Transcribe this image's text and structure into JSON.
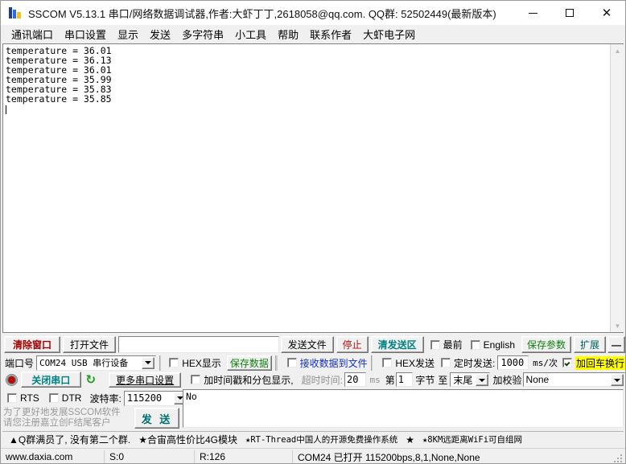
{
  "window": {
    "title": "SSCOM V5.13.1 串口/网络数据调试器,作者:大虾丁丁,2618058@qq.com. QQ群: 52502449(最新版本)",
    "minimize": "─",
    "maximize": "",
    "close": "✕"
  },
  "menu": {
    "items": [
      {
        "label": "通讯端口"
      },
      {
        "label": "串口设置"
      },
      {
        "label": "显示"
      },
      {
        "label": "发送"
      },
      {
        "label": "多字符串"
      },
      {
        "label": "小工具"
      },
      {
        "label": "帮助"
      },
      {
        "label": "联系作者"
      },
      {
        "label": "大虾电子网"
      }
    ]
  },
  "terminal": {
    "text": "temperature = 36.01\ntemperature = 36.13\ntemperature = 36.01\ntemperature = 35.99\ntemperature = 35.83\ntemperature = 35.85\n"
  },
  "toolbar_top": {
    "clear_window": "清除窗口",
    "open_file": "打开文件",
    "file_path": "",
    "send_file": "发送文件",
    "stop": "停止",
    "clear_send_area": "清发送区",
    "always_on_top": "最前",
    "english": "English",
    "save_params": "保存参数",
    "extend": "扩展",
    "dash": "—"
  },
  "port_row": {
    "port_label": "端口号",
    "port_value": "COM24 USB 串行设备",
    "hex_display": "HEX显示",
    "save_data": "保存数据",
    "receive_to_file": "接收数据到文件",
    "hex_send": "HEX发送",
    "timer_send": "定时发送:",
    "interval_value": "1000",
    "ms_per_time": "ms/次",
    "add_crlf": "加回车换行",
    "help_mark": "?"
  },
  "control_row": {
    "close_port": "关闭串口",
    "refresh_icon": "↻",
    "more_settings": "更多串口设置",
    "timestamp_split": "加时间戳和分包显示,",
    "timeout_label": "超时时间:",
    "timeout_value": "20",
    "ms": "ms",
    "nth": "第",
    "byte_from": "1",
    "byte_label": "字节",
    "to_label": "至",
    "end_value": "末尾",
    "checksum_label": "加校验",
    "checksum_value": "None"
  },
  "flow_row": {
    "rts": "RTS",
    "dtr": "DTR",
    "baud_label": "波特率:",
    "baud_value": "115200"
  },
  "send_panel": {
    "send_text": "No",
    "promo_line1": "为了更好地发展SSCOM软件",
    "promo_line2": "请您注册嘉立创F结尾客户",
    "send_button": "发 送"
  },
  "ad_bar": {
    "items": [
      "▲Q群满员了, 没有第二个群.",
      "★合宙高性价比4G模块",
      "★RT-Thread中国人的开源免费操作系统",
      "★",
      "★8KM远距离WiFi可自组网"
    ]
  },
  "status_bar": {
    "website": "www.daxia.com",
    "sent": "S:0",
    "received": "R:126",
    "connection": "COM24 已打开  115200bps,8,1,None,None"
  },
  "colors": {
    "accent_teal": "#008080",
    "accent_red": "#a00000",
    "accent_green": "#108010",
    "accent_blue": "#1030c0",
    "highlight_yellow": "#ffff00",
    "window_bg": "#f0f0f0",
    "terminal_bg": "#ffffff"
  }
}
